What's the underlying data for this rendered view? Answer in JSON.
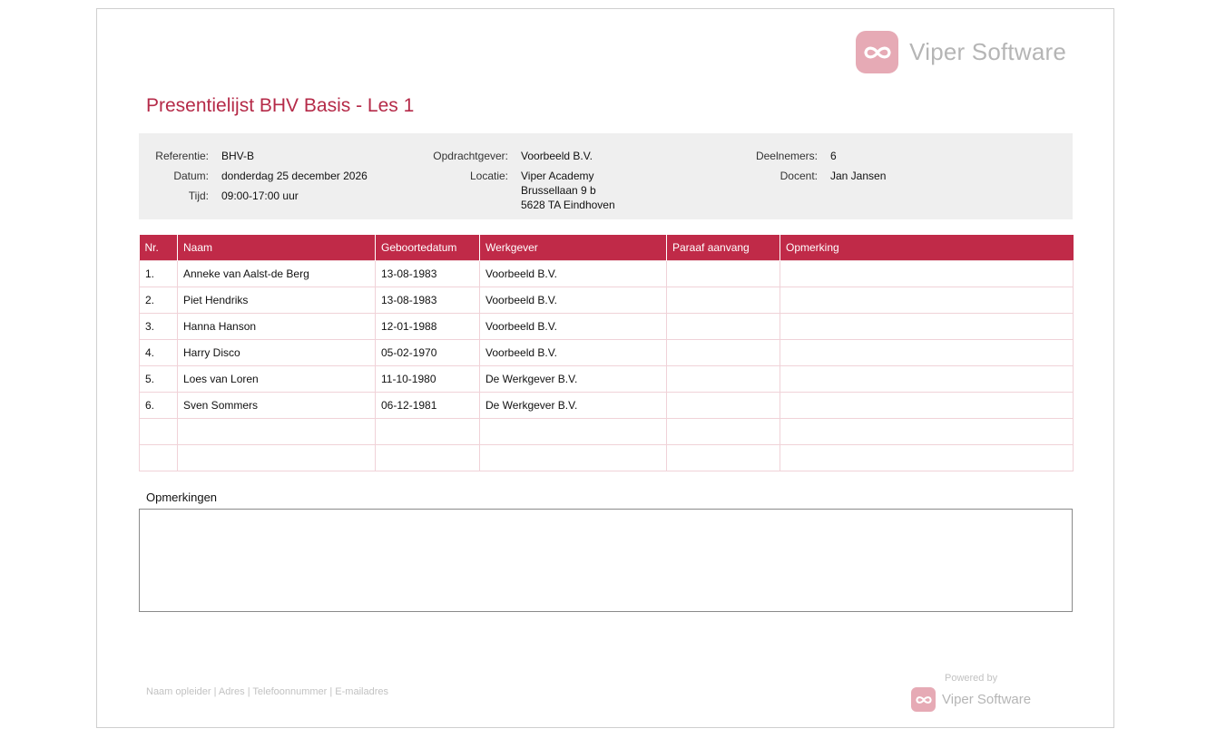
{
  "brand": {
    "logo_text": "Viper Software",
    "accent_color": "#c02a48",
    "logo_color": "#e6aab5"
  },
  "title": "Presentielijst BHV Basis - Les 1",
  "info": {
    "referentie_label": "Referentie:",
    "referentie": "BHV-B",
    "datum_label": "Datum:",
    "datum": "donderdag 25 december 2026",
    "tijd_label": "Tijd:",
    "tijd": "09:00-17:00 uur",
    "opdrachtgever_label": "Opdrachtgever:",
    "opdrachtgever": "Voorbeeld B.V.",
    "locatie_label": "Locatie:",
    "locatie_1": "Viper Academy",
    "locatie_2": "Brussellaan 9 b",
    "locatie_3": "5628 TA Eindhoven",
    "deelnemers_label": "Deelnemers:",
    "deelnemers": "6",
    "docent_label": "Docent:",
    "docent": "Jan Jansen"
  },
  "table": {
    "headers": [
      "Nr.",
      "Naam",
      "Geboortedatum",
      "Werkgever",
      "Paraaf aanvang",
      "Opmerking"
    ],
    "rows": [
      [
        "1.",
        "Anneke van Aalst-de Berg",
        "13-08-1983",
        "Voorbeeld B.V.",
        "",
        ""
      ],
      [
        "2.",
        "Piet Hendriks",
        "13-08-1983",
        "Voorbeeld B.V.",
        "",
        ""
      ],
      [
        "3.",
        "Hanna Hanson",
        "12-01-1988",
        "Voorbeeld B.V.",
        "",
        ""
      ],
      [
        "4.",
        "Harry Disco",
        "05-02-1970",
        "Voorbeeld B.V.",
        "",
        ""
      ],
      [
        "5.",
        "Loes van Loren",
        "11-10-1980",
        "De Werkgever B.V.",
        "",
        ""
      ],
      [
        "6.",
        "Sven Sommers",
        "06-12-1981",
        "De Werkgever B.V.",
        "",
        ""
      ],
      [
        "",
        "",
        "",
        "",
        "",
        ""
      ],
      [
        "",
        "",
        "",
        "",
        "",
        ""
      ]
    ]
  },
  "remarks_label": "Opmerkingen",
  "footer": {
    "left": "Naam opleider | Adres | Telefoonnummer | E-mailadres",
    "powered_by": "Powered by",
    "powered_logo_text": "Viper Software"
  }
}
